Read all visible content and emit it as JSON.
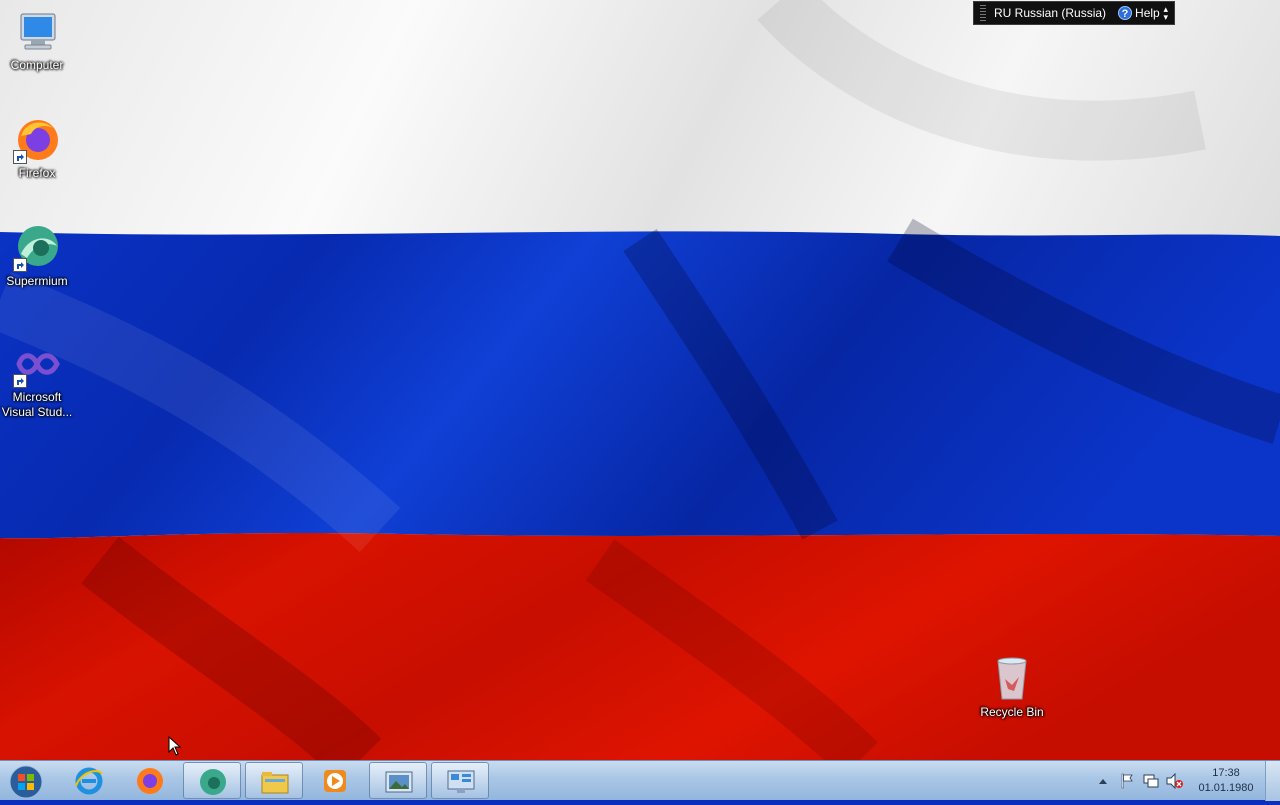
{
  "desktop": {
    "icons": [
      {
        "label": "Computer",
        "icon": "computer-icon"
      },
      {
        "label": "Firefox",
        "icon": "firefox-icon"
      },
      {
        "label": "Supermium",
        "icon": "supermium-icon"
      },
      {
        "label": "Microsoft Visual Stud...",
        "icon": "visual-studio-icon"
      },
      {
        "label": "Recycle Bin",
        "icon": "recycle-bin-icon"
      }
    ],
    "wallpaper": "russian-flag",
    "colors": {
      "white": "#f2f2f2",
      "blue": "#0a2fbf",
      "red": "#d10f00"
    }
  },
  "langbar": {
    "language": "RU Russian (Russia)",
    "help": "Help",
    "help_glyph": "?"
  },
  "taskbar": {
    "start": "start-orb-icon",
    "pinned": [
      {
        "name": "internet-explorer-icon"
      },
      {
        "name": "firefox-icon"
      },
      {
        "name": "supermium-icon"
      },
      {
        "name": "file-explorer-icon"
      },
      {
        "name": "media-player-icon"
      },
      {
        "name": "picture-viewer-icon"
      },
      {
        "name": "control-panel-icon"
      }
    ],
    "tray": [
      "show-hidden-icons-icon",
      "action-center-flag-icon",
      "network-icon",
      "volume-muted-icon"
    ],
    "clock": {
      "time": "17:38",
      "date": "01.01.1980"
    }
  }
}
